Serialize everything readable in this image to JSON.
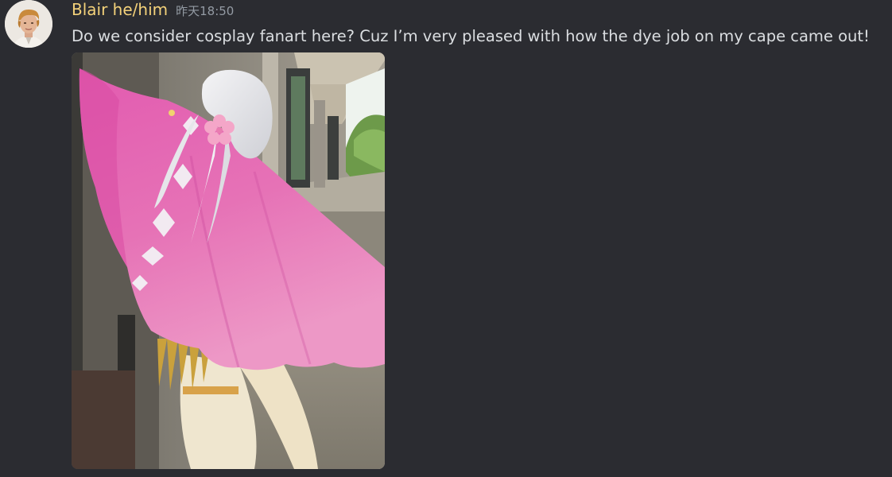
{
  "message": {
    "author": "Blair he/him",
    "timestamp": "昨天18:50",
    "text": "Do we consider cosplay fanart here? Cuz I’m very pleased with how the dye job on my cape came out!",
    "author_color": "#f4d27a",
    "attachment": {
      "kind": "photo"
    }
  },
  "colors": {
    "background": "#2b2c31",
    "message_text": "#dbdee1",
    "timestamp": "#949ba4"
  },
  "icons": {
    "avatar": "avatar-image"
  }
}
